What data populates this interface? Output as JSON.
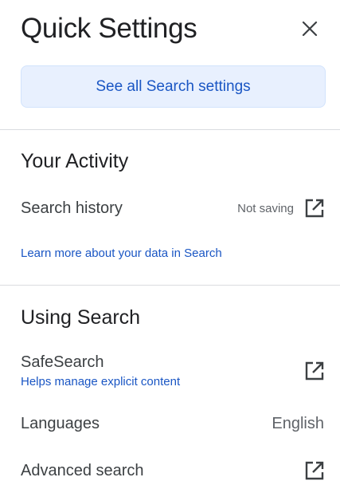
{
  "header": {
    "title": "Quick Settings",
    "close_icon": "close-icon"
  },
  "see_all": {
    "label": "See all Search settings"
  },
  "your_activity": {
    "title": "Your Activity",
    "search_history": {
      "label": "Search history",
      "status": "Not saving",
      "icon": "open-in-new-icon"
    },
    "learn_more": "Learn more about your data in Search"
  },
  "using_search": {
    "title": "Using Search",
    "safesearch": {
      "label": "SafeSearch",
      "sublabel": "Helps manage explicit content",
      "icon": "open-in-new-icon"
    },
    "languages": {
      "label": "Languages",
      "value": "English"
    },
    "advanced_search": {
      "label": "Advanced search",
      "icon": "open-in-new-icon"
    }
  },
  "colors": {
    "accent": "#1a56c4",
    "button_bg": "#e8f0fe",
    "text_primary": "#202124",
    "text_secondary": "#5f6368",
    "divider": "#dadce0"
  }
}
